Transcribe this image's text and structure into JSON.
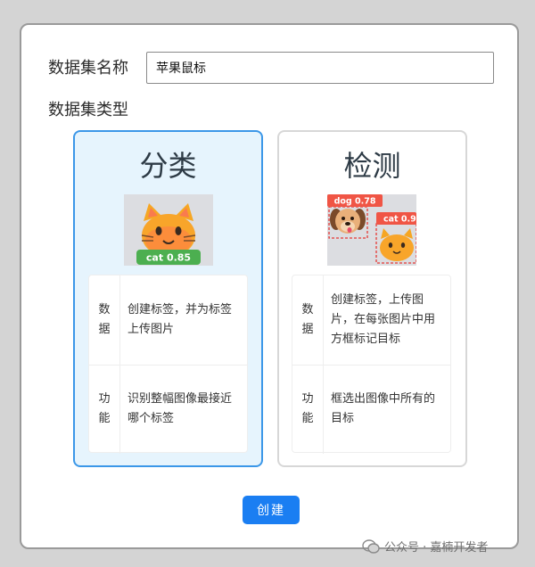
{
  "form": {
    "name_label": "数据集名称",
    "name_value": "苹果鼠标",
    "type_label": "数据集类型"
  },
  "cards": [
    {
      "title": "分类",
      "selected": true,
      "image_tag": "cat 0.85",
      "data_head": "数\n据",
      "data_text": "创建标签，并为标签上传图片",
      "func_head": "功\n能",
      "func_text": "识别整幅图像最接近哪个标签"
    },
    {
      "title": "检测",
      "selected": false,
      "image_tags": [
        "dog 0.78",
        "cat 0.9"
      ],
      "data_head": "数\n据",
      "data_text": "创建标签，上传图片，在每张图片中用方框标记目标",
      "func_head": "功\n能",
      "func_text": "框选出图像中所有的目标"
    }
  ],
  "create_button": "创建",
  "watermark": "公众号 · 嘉楠开发者",
  "colors": {
    "accent": "#1a7ef2",
    "selected_border": "#3b97e8",
    "selected_bg": "#e6f4fd",
    "tag_green": "#4caf50",
    "tag_red": "#f05545"
  }
}
